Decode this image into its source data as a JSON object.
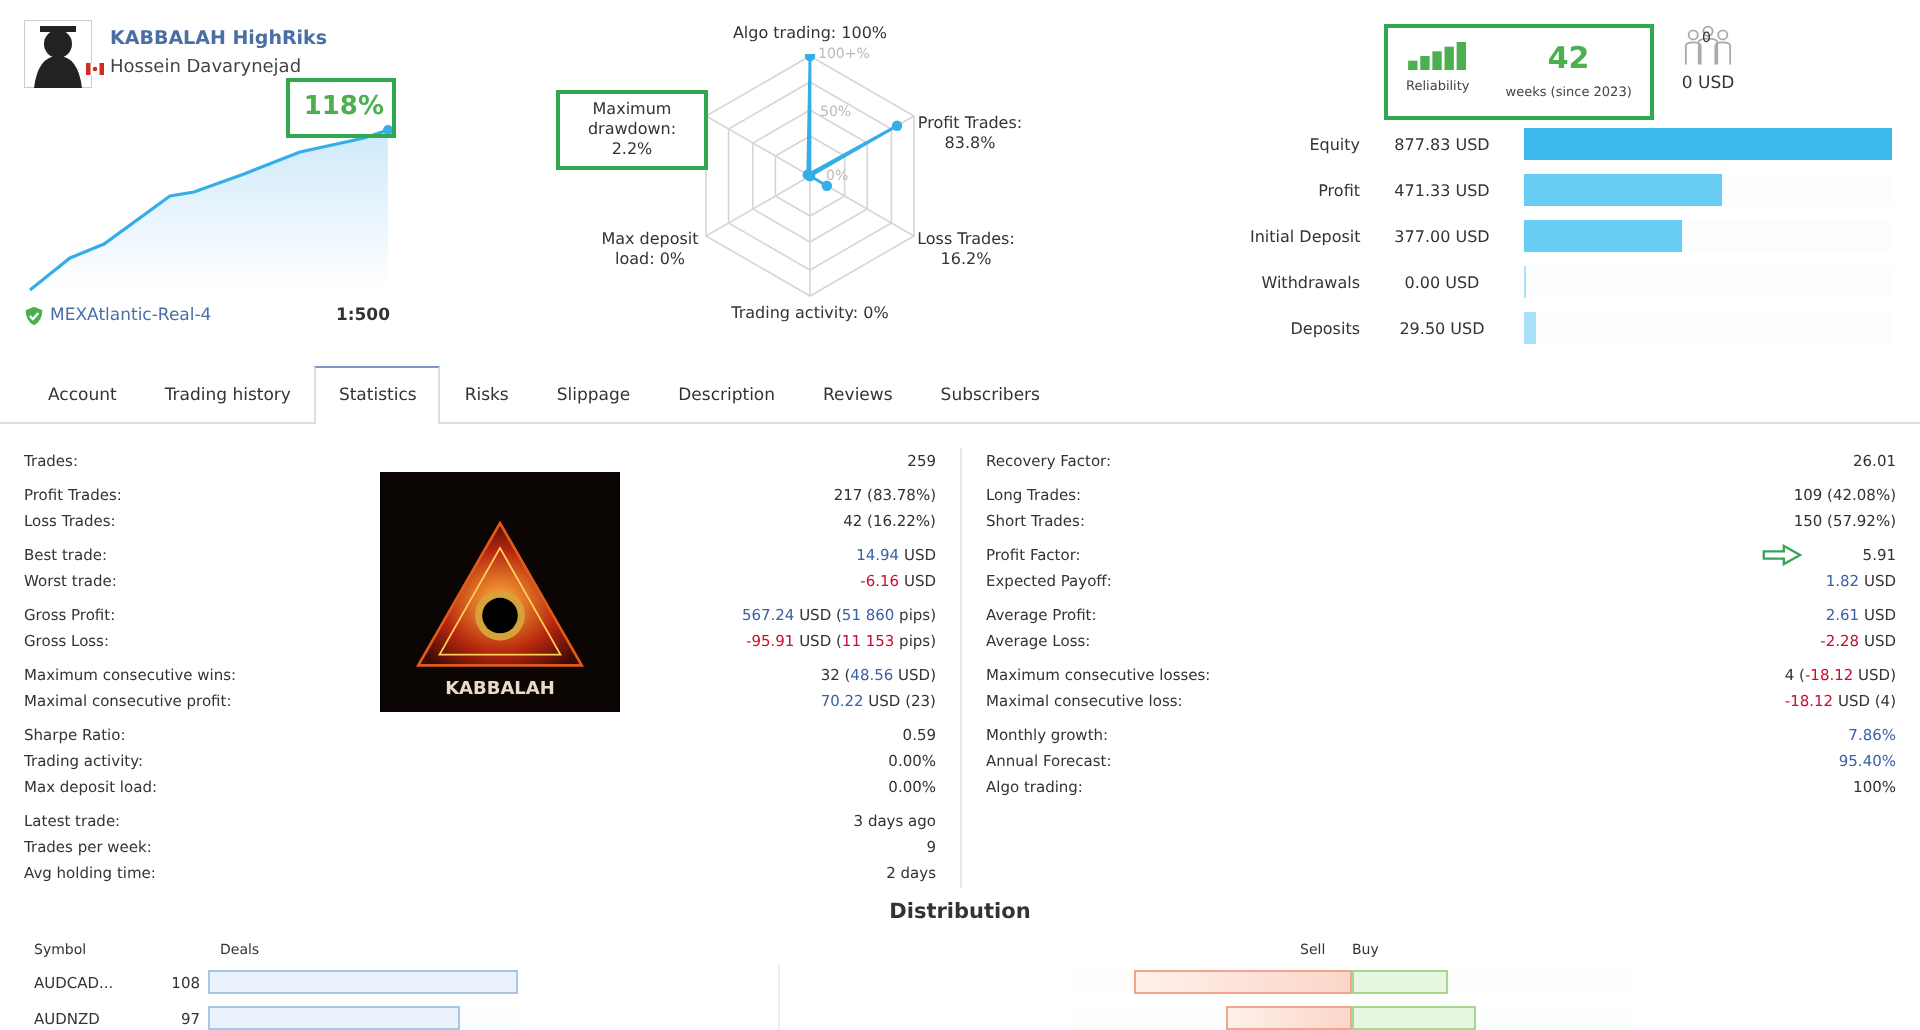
{
  "profile": {
    "name": "KABBALAH HighRiks",
    "author": "Hossein Davarynejad",
    "growth": "118%",
    "growth_highlighted": true,
    "server": "MEXAtlantic-Real-4",
    "leverage": "1:500"
  },
  "radar": {
    "ticks": [
      "100+%",
      "50%",
      "0%"
    ],
    "axes": [
      {
        "label": "Algo trading: 100%",
        "level": 1.0,
        "highlighted": false
      },
      {
        "label": "Maximum drawdown: 2.2%",
        "level": 0.022,
        "highlighted": true
      },
      {
        "label": "Profit Trades: 83.8%",
        "level": 0.838,
        "highlighted": false
      },
      {
        "label": "Max deposit load: 0%",
        "level": 0,
        "highlighted": false
      },
      {
        "label": "Loss Trades: 16.2%",
        "level": 0.162,
        "highlighted": false
      },
      {
        "label": "Trading activity: 0%",
        "level": 0,
        "highlighted": false
      }
    ]
  },
  "reliability": {
    "label": "Reliability",
    "weeks": "42",
    "weeks_caption": "weeks (since 2023)",
    "highlighted": true
  },
  "subscribers": {
    "count": "0",
    "amount": "0 USD"
  },
  "balance": [
    {
      "label": "Equity",
      "value": "877.83 USD",
      "level": 1.0,
      "color": "#3cb9ec"
    },
    {
      "label": "Profit",
      "value": "471.33 USD",
      "level": 0.54,
      "color": "#67cdf2"
    },
    {
      "label": "Initial Deposit",
      "value": "377.00 USD",
      "level": 0.43,
      "color": "#67cdf2"
    },
    {
      "label": "Withdrawals",
      "value": "0.00 USD",
      "level": 0.005,
      "color": "#a9e2f8"
    },
    {
      "label": "Deposits",
      "value": "29.50 USD",
      "level": 0.034,
      "color": "#a9e2f8"
    }
  ],
  "tabs": [
    {
      "label": "Account",
      "selected": false
    },
    {
      "label": "Trading history",
      "selected": false
    },
    {
      "label": "Statistics",
      "selected": true
    },
    {
      "label": "Risks",
      "selected": false
    },
    {
      "label": "Slippage",
      "selected": false
    },
    {
      "label": "Description",
      "selected": false
    },
    {
      "label": "Reviews",
      "selected": false
    },
    {
      "label": "Subscribers",
      "selected": false
    }
  ],
  "cover_image": {
    "caption": "KABBALAH"
  },
  "statistics": {
    "left": [
      [
        {
          "label": "Trades:",
          "marked": false,
          "value": [
            {
              "text": "259",
              "kind": "plain"
            }
          ]
        }
      ],
      [
        {
          "label": "Profit Trades:",
          "marked": false,
          "value": [
            {
              "text": "217 (83.78%)",
              "kind": "plain"
            }
          ]
        },
        {
          "label": "Loss Trades:",
          "marked": false,
          "value": [
            {
              "text": "42 (16.22%)",
              "kind": "plain"
            }
          ]
        }
      ],
      [
        {
          "label": "Best trade:",
          "marked": false,
          "value": [
            {
              "text": "14.94",
              "kind": "gain"
            },
            {
              "text": " USD",
              "kind": "plain"
            }
          ]
        },
        {
          "label": "Worst trade:",
          "marked": false,
          "value": [
            {
              "text": "-6.16",
              "kind": "loss"
            },
            {
              "text": " USD",
              "kind": "plain"
            }
          ]
        }
      ],
      [
        {
          "label": "Gross Profit:",
          "marked": false,
          "value": [
            {
              "text": "567.24",
              "kind": "gain"
            },
            {
              "text": " USD (",
              "kind": "plain"
            },
            {
              "text": "51 860",
              "kind": "gain"
            },
            {
              "text": " pips)",
              "kind": "plain"
            }
          ]
        },
        {
          "label": "Gross Loss:",
          "marked": false,
          "value": [
            {
              "text": "-95.91",
              "kind": "loss"
            },
            {
              "text": " USD (",
              "kind": "plain"
            },
            {
              "text": "11 153",
              "kind": "loss"
            },
            {
              "text": " pips)",
              "kind": "plain"
            }
          ]
        }
      ],
      [
        {
          "label": "Maximum consecutive wins:",
          "marked": false,
          "value": [
            {
              "text": "32 (",
              "kind": "plain"
            },
            {
              "text": "48.56",
              "kind": "gain"
            },
            {
              "text": " USD)",
              "kind": "plain"
            }
          ]
        },
        {
          "label": "Maximal consecutive profit:",
          "marked": false,
          "value": [
            {
              "text": "70.22",
              "kind": "gain"
            },
            {
              "text": " USD (23)",
              "kind": "plain"
            }
          ]
        }
      ],
      [
        {
          "label": "Sharpe Ratio:",
          "marked": false,
          "value": [
            {
              "text": "0.59",
              "kind": "plain"
            }
          ]
        },
        {
          "label": "Trading activity:",
          "marked": false,
          "value": [
            {
              "text": "0.00%",
              "kind": "plain"
            }
          ]
        },
        {
          "label": "Max deposit load:",
          "marked": false,
          "value": [
            {
              "text": "0.00%",
              "kind": "plain"
            }
          ]
        }
      ],
      [
        {
          "label": "Latest trade:",
          "marked": false,
          "value": [
            {
              "text": "3 days ago",
              "kind": "plain"
            }
          ]
        },
        {
          "label": "Trades per week:",
          "marked": false,
          "value": [
            {
              "text": "9",
              "kind": "plain"
            }
          ]
        },
        {
          "label": "Avg holding time:",
          "marked": false,
          "value": [
            {
              "text": "2 days",
              "kind": "plain"
            }
          ]
        }
      ]
    ],
    "right": [
      [
        {
          "label": "Recovery Factor:",
          "marked": false,
          "value": [
            {
              "text": "26.01",
              "kind": "plain"
            }
          ]
        }
      ],
      [
        {
          "label": "Long Trades:",
          "marked": false,
          "value": [
            {
              "text": "109 (42.08%)",
              "kind": "plain"
            }
          ]
        },
        {
          "label": "Short Trades:",
          "marked": false,
          "value": [
            {
              "text": "150 (57.92%)",
              "kind": "plain"
            }
          ]
        }
      ],
      [
        {
          "label": "Profit Factor:",
          "marked": true,
          "value": [
            {
              "text": "5.91",
              "kind": "plain"
            }
          ]
        },
        {
          "label": "Expected Payoff:",
          "marked": false,
          "value": [
            {
              "text": "1.82",
              "kind": "gain"
            },
            {
              "text": " USD",
              "kind": "plain"
            }
          ]
        }
      ],
      [
        {
          "label": "Average Profit:",
          "marked": false,
          "value": [
            {
              "text": "2.61",
              "kind": "gain"
            },
            {
              "text": " USD",
              "kind": "plain"
            }
          ]
        },
        {
          "label": "Average Loss:",
          "marked": false,
          "value": [
            {
              "text": "-2.28",
              "kind": "loss"
            },
            {
              "text": " USD",
              "kind": "plain"
            }
          ]
        }
      ],
      [
        {
          "label": "Maximum consecutive losses:",
          "marked": false,
          "value": [
            {
              "text": "4 (",
              "kind": "plain"
            },
            {
              "text": "-18.12",
              "kind": "loss"
            },
            {
              "text": " USD)",
              "kind": "plain"
            }
          ]
        },
        {
          "label": "Maximal consecutive loss:",
          "marked": false,
          "value": [
            {
              "text": "-18.12",
              "kind": "loss"
            },
            {
              "text": " USD (4)",
              "kind": "plain"
            }
          ]
        }
      ],
      [
        {
          "label": "Monthly growth:",
          "marked": false,
          "value": [
            {
              "text": "7.86%",
              "kind": "gain"
            }
          ]
        },
        {
          "label": "Annual Forecast:",
          "marked": false,
          "value": [
            {
              "text": "95.40%",
              "kind": "gain"
            }
          ]
        },
        {
          "label": "Algo trading:",
          "marked": false,
          "value": [
            {
              "text": "100%",
              "kind": "plain"
            }
          ]
        }
      ]
    ]
  },
  "distribution": {
    "title": "Distribution",
    "columns": {
      "symbol": "Symbol",
      "deals": "Deals",
      "sell": "Sell",
      "buy": "Buy"
    },
    "rows": [
      {
        "symbol": "AUDCAD...",
        "deals": {
          "count": "108",
          "level": 1.0
        },
        "sell": {
          "level": 0.78
        },
        "buy": {
          "level": 0.34
        }
      },
      {
        "symbol": "AUDNZD",
        "deals": {
          "count": "97",
          "level": 0.81
        },
        "sell": {
          "level": 0.45
        },
        "buy": {
          "level": 0.44
        }
      }
    ]
  }
}
